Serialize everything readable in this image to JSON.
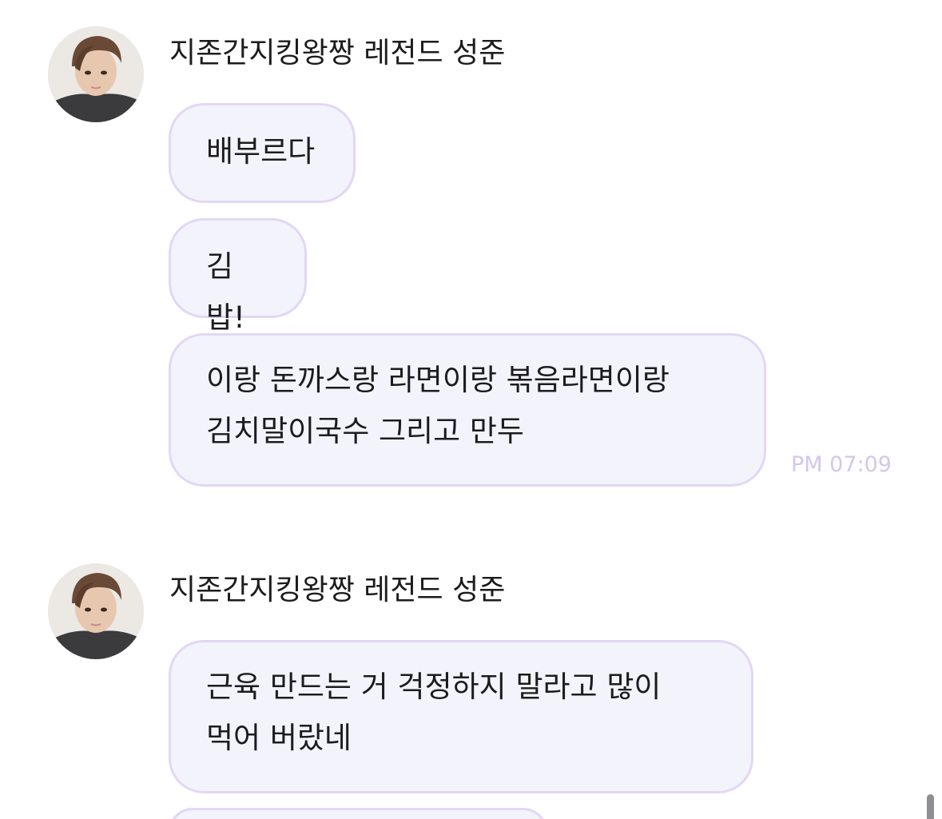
{
  "messages": [
    {
      "sender": "지존간지킹왕짱 레전드 성준",
      "bubbles": [
        "배부르다",
        "김밥!",
        "이랑 돈까스랑 라면이랑 볶음라면이랑 김치말이국수 그리고 만두"
      ],
      "time": "PM 07:09"
    },
    {
      "sender": "지존간지킹왕짱 레전드 성준",
      "bubbles": [
        "근육 만드는 거 걱정하지 말라고 많이 먹어 버랐네",
        ""
      ]
    }
  ]
}
